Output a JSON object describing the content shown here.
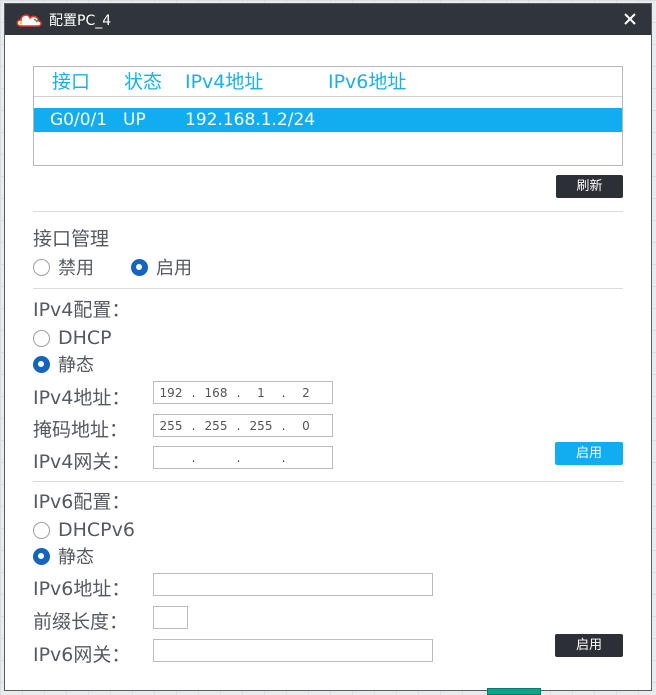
{
  "window": {
    "title": "配置PC_4",
    "icon": "cloud-logo-icon",
    "close_icon": "close-icon"
  },
  "interfaces": {
    "headers": [
      "接口",
      "状态",
      "IPv4地址",
      "IPv6地址"
    ],
    "rows": [
      {
        "interface": "G0/0/1",
        "status": "UP",
        "ipv4": "192.168.1.2/24",
        "ipv6": ""
      }
    ],
    "selected_color": "#12adf0"
  },
  "refresh_button": "刷新",
  "interface_mgmt": {
    "title": "接口管理",
    "options": [
      {
        "label": "禁用",
        "selected": false
      },
      {
        "label": "启用",
        "selected": true
      }
    ]
  },
  "ipv4": {
    "title": "IPv4配置：",
    "options": [
      {
        "label": "DHCP",
        "selected": false
      },
      {
        "label": "静态",
        "selected": true
      }
    ],
    "address_label": "IPv4地址：",
    "address": [
      "192",
      "168",
      "1",
      "2"
    ],
    "mask_label": "掩码地址：",
    "mask": [
      "255",
      "255",
      "255",
      "0"
    ],
    "gateway_label": "IPv4网关：",
    "gateway": [
      "",
      "",
      "",
      ""
    ],
    "apply_button": "启用"
  },
  "ipv6": {
    "title": "IPv6配置：",
    "options": [
      {
        "label": "DHCPv6",
        "selected": false
      },
      {
        "label": "静态",
        "selected": true
      }
    ],
    "address_label": "IPv6地址：",
    "address": "",
    "prefix_label": "前缀长度：",
    "prefix": "",
    "gateway_label": "IPv6网关：",
    "gateway": "",
    "apply_button": "启用"
  }
}
